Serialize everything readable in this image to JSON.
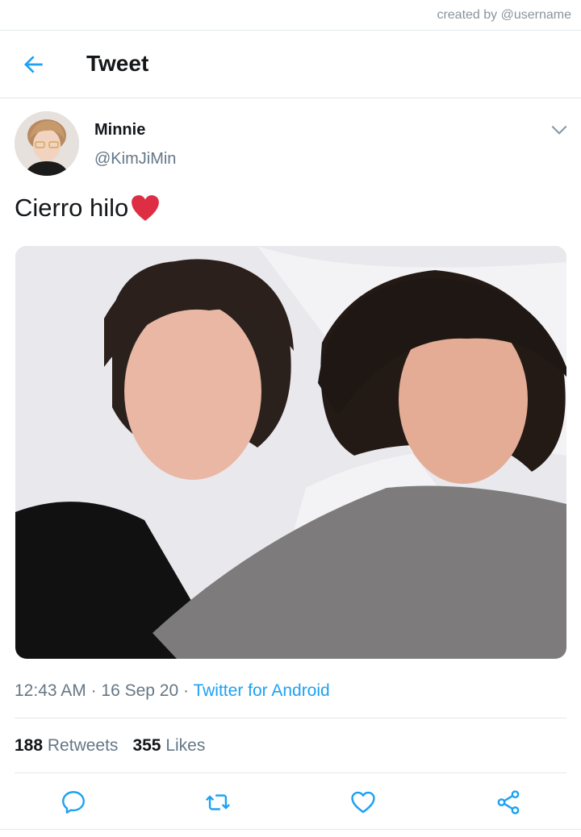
{
  "credit": "created by @username",
  "header": {
    "title": "Tweet"
  },
  "author": {
    "name": "Minnie",
    "handle": "@KimJiMin"
  },
  "tweet": {
    "text": "Cierro hilo",
    "emoji": "red-heart",
    "time": "12:43 AM",
    "separator": " · ",
    "date": "16 Sep 20",
    "source": "Twitter for Android"
  },
  "stats": {
    "retweets_count": "188",
    "retweets_label": "Retweets",
    "likes_count": "355",
    "likes_label": "Likes"
  },
  "icons": {
    "back": "arrow-left-icon",
    "more": "chevron-down-icon",
    "reply": "reply-icon",
    "retweet": "retweet-icon",
    "like": "heart-icon",
    "share": "share-icon"
  },
  "colors": {
    "accent": "#1da1f2",
    "muted": "#657786",
    "heart": "#dd2e44"
  }
}
